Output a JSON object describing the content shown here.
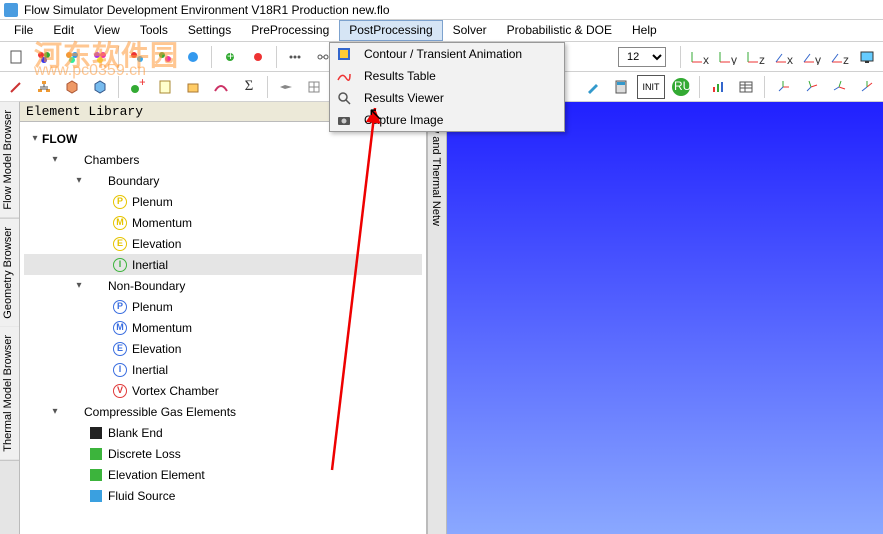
{
  "window": {
    "title": "Flow Simulator Development Environment V18R1 Production new.flo"
  },
  "menu": {
    "items": [
      "File",
      "Edit",
      "View",
      "Tools",
      "Settings",
      "PreProcessing",
      "PostProcessing",
      "Solver",
      "Probabilistic & DOE",
      "Help"
    ],
    "active_index": 6
  },
  "dropdown": {
    "items": [
      {
        "icon": "contour-anim-icon",
        "label": "Contour / Transient Animation"
      },
      {
        "icon": "results-table-icon",
        "label": "Results Table"
      },
      {
        "icon": "results-viewer-icon",
        "label": "Results Viewer"
      },
      {
        "icon": "capture-image-icon",
        "label": "Capture Image"
      }
    ]
  },
  "combo": {
    "value": "12"
  },
  "left_tabs": [
    "Flow Model Browser",
    "Geometry Browser",
    "Thermal Model Browser"
  ],
  "right_tab": "Flow and Thermal Netw",
  "library": {
    "header": "Element Library"
  },
  "tree": {
    "root": {
      "label": "FLOW"
    },
    "nodes": [
      {
        "depth": 1,
        "exp": "v",
        "ic": "",
        "label": "Chambers"
      },
      {
        "depth": 2,
        "exp": "v",
        "ic": "",
        "label": "Boundary"
      },
      {
        "depth": 3,
        "exp": "",
        "ic": "P-y",
        "label": "Plenum"
      },
      {
        "depth": 3,
        "exp": "",
        "ic": "M-y",
        "label": "Momentum"
      },
      {
        "depth": 3,
        "exp": "",
        "ic": "E-y",
        "label": "Elevation"
      },
      {
        "depth": 3,
        "exp": "",
        "ic": "I-g",
        "label": "Inertial",
        "sel": true
      },
      {
        "depth": 2,
        "exp": "v",
        "ic": "",
        "label": "Non-Boundary"
      },
      {
        "depth": 3,
        "exp": "",
        "ic": "P-b",
        "label": "Plenum"
      },
      {
        "depth": 3,
        "exp": "",
        "ic": "M-b",
        "label": "Momentum"
      },
      {
        "depth": 3,
        "exp": "",
        "ic": "E-b",
        "label": "Elevation"
      },
      {
        "depth": 3,
        "exp": "",
        "ic": "I-b",
        "label": "Inertial"
      },
      {
        "depth": 3,
        "exp": "",
        "ic": "V-r",
        "label": "Vortex Chamber"
      },
      {
        "depth": 1,
        "exp": "v",
        "ic": "",
        "label": "Compressible Gas Elements"
      },
      {
        "depth": 2,
        "exp": "",
        "ic": "BE",
        "label": "Blank End"
      },
      {
        "depth": 2,
        "exp": "",
        "ic": "DL",
        "label": "Discrete Loss"
      },
      {
        "depth": 2,
        "exp": "",
        "ic": "EE",
        "label": "Elevation Element"
      },
      {
        "depth": 2,
        "exp": "",
        "ic": "FS",
        "label": "Fluid Source"
      }
    ]
  },
  "watermark": {
    "line1": "河东软件园",
    "line2": "www.pc0359.cn"
  },
  "toolbar1_icons": [
    "new",
    "open",
    "save",
    "print",
    "cut",
    "copy",
    "paste",
    "undo",
    "redo",
    "grid",
    "snap",
    "layer",
    "zoom",
    "ortho",
    "perspective",
    "iso-xy",
    "iso-xz",
    "iso-yz",
    "iso-xyz",
    "fit",
    "screen"
  ],
  "toolbar2_icons": [
    "link",
    "tree",
    "cube1",
    "cube2",
    "add",
    "page",
    "box",
    "curve",
    "sum",
    "plane",
    "mesh",
    "notch",
    "calc",
    "init",
    "run",
    "chart",
    "table",
    "axis1",
    "axis2",
    "axis3",
    "axis4"
  ]
}
